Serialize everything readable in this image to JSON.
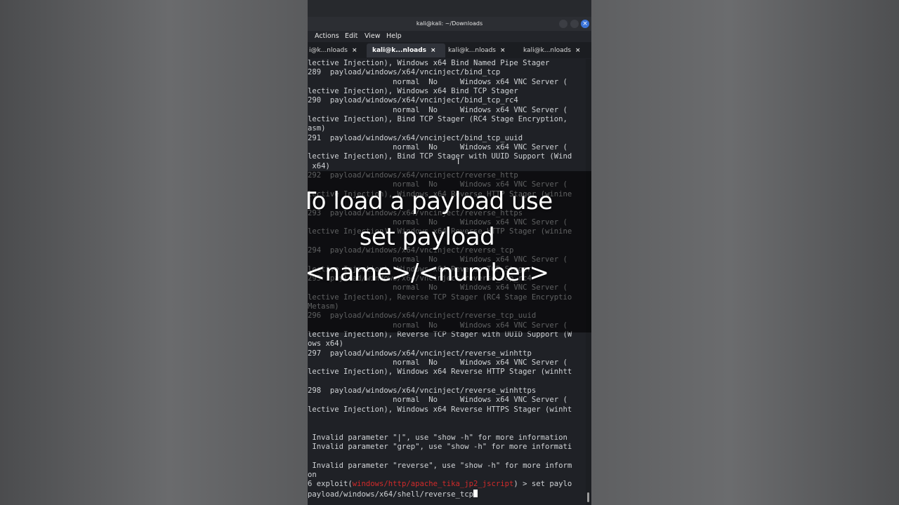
{
  "window": {
    "title": "kali@kali: ~/Downloads",
    "close_glyph": "×"
  },
  "menu": [
    "Actions",
    "Edit",
    "View",
    "Help"
  ],
  "tabs": [
    {
      "label": "i@k...nloads",
      "close": "×",
      "active": false
    },
    {
      "label": "kali@k...nloads",
      "close": "×",
      "active": true
    },
    {
      "label": "kali@k...nloads",
      "close": "×",
      "active": false
    },
    {
      "label": "kali@k...nloads",
      "close": "×",
      "active": false
    }
  ],
  "terminal_lines": [
    "lective Injection), Windows x64 Bind Named Pipe Stager",
    "289  payload/windows/x64/vncinject/bind_tcp",
    "                   normal  No     Windows x64 VNC Server (",
    "lective Injection), Windows x64 Bind TCP Stager",
    "290  payload/windows/x64/vncinject/bind_tcp_rc4",
    "                   normal  No     Windows x64 VNC Server (",
    "lective Injection), Bind TCP Stager (RC4 Stage Encryption,",
    "asm)",
    "291  payload/windows/x64/vncinject/bind_tcp_uuid",
    "                   normal  No     Windows x64 VNC Server (",
    "lective Injection), Bind TCP Stager with UUID Support (Wind",
    " x64)",
    "292  payload/windows/x64/vncinject/reverse_http",
    "                   normal  No     Windows x64 VNC Server (",
    "lective Injection), Windows x64 Reverse HTTP Stager (winine",
    "",
    "293  payload/windows/x64/vncinject/reverse_https",
    "                   normal  No     Windows x64 VNC Server (",
    "lective Injection), Windows x64 Reverse HTTP Stager (winine",
    "",
    "294  payload/windows/x64/vncinject/reverse_tcp",
    "                   normal  No     Windows x64 VNC Server (",
    "lective Injection), Windows x64 Reverse TCP Stager",
    "295  payload/windows/x64/vncinject/reverse_tcp_rc4",
    "                   normal  No     Windows x64 VNC Server (",
    "lective Injection), Reverse TCP Stager (RC4 Stage Encryptio",
    "Metasm)",
    "296  payload/windows/x64/vncinject/reverse_tcp_uuid",
    "                   normal  No     Windows x64 VNC Server (",
    "lective Injection), Reverse TCP Stager with UUID Support (W",
    "ows x64)",
    "297  payload/windows/x64/vncinject/reverse_winhttp",
    "                   normal  No     Windows x64 VNC Server (",
    "lective Injection), Windows x64 Reverse HTTP Stager (winhtt",
    "",
    "298  payload/windows/x64/vncinject/reverse_winhttps",
    "                   normal  No     Windows x64 VNC Server (",
    "lective Injection), Windows x64 Reverse HTTPS Stager (winht",
    "",
    "",
    " Invalid parameter \"|\", use \"show -h\" for more information",
    " Invalid parameter \"grep\", use \"show -h\" for more informati",
    "",
    " Invalid parameter \"reverse\", use \"show -h\" for more inform",
    "on"
  ],
  "prompt": {
    "prefix": "6 exploit(",
    "module": "windows/http/apache_tika_jp2_jscript",
    "suffix": ") > set paylo",
    "continuation": "payload/windows/x64/shell/reverse_tcp"
  },
  "caption": {
    "line1": "To load a payload use",
    "line2": "set payload",
    "line3": "<name>/<number>"
  },
  "colors": {
    "terminal_bg": "#1f2126",
    "terminal_text": "#d0d3d6",
    "module_red": "#d12a2a",
    "close_button": "#3b74d9"
  },
  "icons": {
    "pointer": "mouse-pointer-icon"
  }
}
